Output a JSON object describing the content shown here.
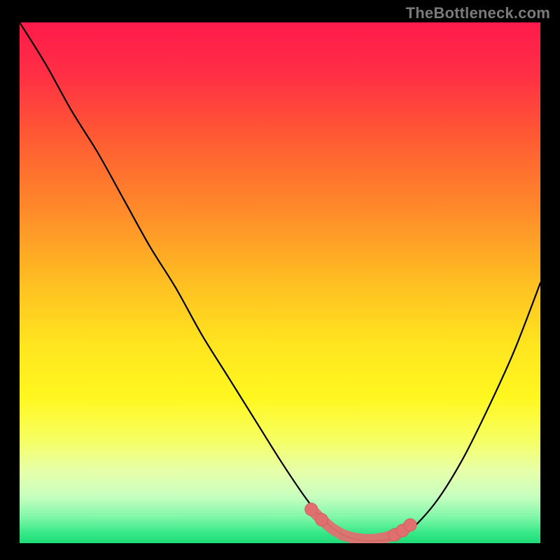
{
  "watermark": "TheBottleneck.com",
  "colors": {
    "background": "#000000",
    "gradient_stops": [
      {
        "offset": 0.0,
        "color": "#ff1a4b"
      },
      {
        "offset": 0.1,
        "color": "#ff2f45"
      },
      {
        "offset": 0.22,
        "color": "#ff5a33"
      },
      {
        "offset": 0.36,
        "color": "#ff8a2a"
      },
      {
        "offset": 0.5,
        "color": "#ffbf22"
      },
      {
        "offset": 0.62,
        "color": "#ffe51f"
      },
      {
        "offset": 0.72,
        "color": "#fff71f"
      },
      {
        "offset": 0.8,
        "color": "#f6ff60"
      },
      {
        "offset": 0.86,
        "color": "#e7ffa8"
      },
      {
        "offset": 0.91,
        "color": "#c8ffc0"
      },
      {
        "offset": 0.95,
        "color": "#80f7a8"
      },
      {
        "offset": 0.98,
        "color": "#38e889"
      },
      {
        "offset": 1.0,
        "color": "#1edb78"
      }
    ],
    "curve": "#000000",
    "marker_fill": "#e07070",
    "marker_stroke": "#d45f5f"
  },
  "chart_data": {
    "type": "line",
    "title": "",
    "xlabel": "",
    "ylabel": "",
    "xlim": [
      0,
      100
    ],
    "ylim": [
      0,
      100
    ],
    "series": [
      {
        "name": "bottleneck-curve",
        "x": [
          0,
          5,
          10,
          15,
          20,
          25,
          30,
          35,
          40,
          45,
          50,
          54,
          57,
          60,
          63,
          66,
          69,
          72,
          75,
          80,
          85,
          90,
          95,
          100
        ],
        "y": [
          100,
          92,
          83,
          75,
          66,
          57,
          49,
          40,
          32,
          24,
          16,
          10,
          6,
          3,
          1.2,
          0.5,
          0.5,
          1.0,
          2.5,
          8,
          16,
          26,
          37,
          50
        ]
      }
    ],
    "markers": {
      "name": "highlight-points",
      "x": [
        56,
        58,
        60,
        62,
        64,
        66,
        68,
        70,
        72,
        73.5,
        75
      ],
      "y": [
        6.5,
        4.5,
        2.8,
        1.6,
        1.0,
        0.7,
        0.7,
        1.0,
        1.6,
        2.4,
        3.5
      ]
    }
  }
}
